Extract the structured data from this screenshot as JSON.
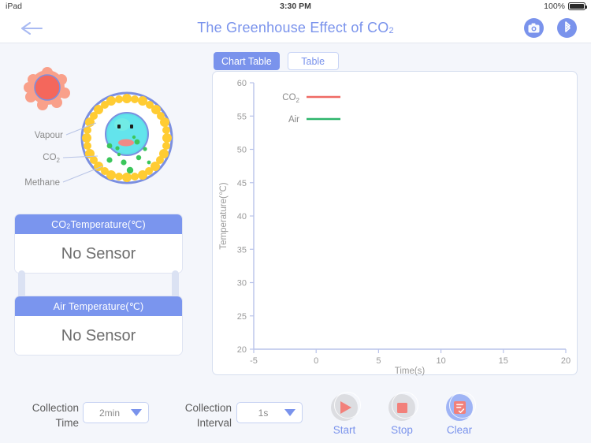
{
  "status_bar": {
    "device": "iPad",
    "time": "3:30 PM",
    "battery_percent": "100%"
  },
  "navbar": {
    "back_icon": "back-arrow-icon",
    "title_main": "The Greenhouse Effect of CO",
    "title_sub": "2",
    "camera_icon": "camera-icon",
    "bluetooth_icon": "bluetooth-icon"
  },
  "illustration": {
    "labels": {
      "vapour": "Vapour",
      "co2": "CO",
      "co2_sub": "2",
      "methane": "Methane"
    },
    "colors": {
      "sun": "#f47c6e",
      "sun_halo": "#f9a08a",
      "atmosphere_ring": "#7b8fe0",
      "methane_dots": "#ffcc33",
      "earth": "#5fe0e8",
      "co2_dots": "#3cc65b"
    }
  },
  "sensors": [
    {
      "title_main": "CO",
      "title_sub": "2",
      "title_rest": " Temperature(℃)",
      "value": "No Sensor"
    },
    {
      "title_main": "Air Temperature(℃)",
      "title_sub": "",
      "title_rest": "",
      "value": "No Sensor"
    }
  ],
  "tabs": [
    {
      "label": "Chart Table",
      "active": true
    },
    {
      "label": "Table",
      "active": false
    }
  ],
  "chart_data": {
    "type": "line",
    "title": "",
    "xlabel": "Time(s)",
    "ylabel": "Temperature(℃)",
    "xlim": [
      -5,
      20
    ],
    "ylim": [
      20,
      60
    ],
    "xticks": [
      "-5",
      "0",
      "5",
      "10",
      "15",
      "20"
    ],
    "yticks": [
      "20",
      "25",
      "30",
      "35",
      "40",
      "45",
      "50",
      "55",
      "60"
    ],
    "grid": false,
    "legend_position": "top-left-inside",
    "series": [
      {
        "name": "CO₂",
        "color": "#ef6a64",
        "x": [],
        "values": []
      },
      {
        "name": "Air",
        "color": "#2cb56b",
        "x": [],
        "values": []
      }
    ]
  },
  "controls": {
    "collection_time_label_line1": "Collection",
    "collection_time_label_line2": "Time",
    "collection_time_value": "2min",
    "collection_interval_label_line1": "Collection",
    "collection_interval_label_line2": "Interval",
    "collection_interval_value": "1s",
    "actions": [
      {
        "label": "Start",
        "icon": "play-icon"
      },
      {
        "label": "Stop",
        "icon": "stop-icon"
      },
      {
        "label": "Clear",
        "icon": "clear-document-icon"
      }
    ]
  },
  "theme": {
    "accent_blue": "#7a93ec",
    "panel_header_blue": "#7a95ee",
    "background": "#f4f6fb",
    "co2_series": "#ef6a64",
    "air_series": "#2cb56b"
  }
}
